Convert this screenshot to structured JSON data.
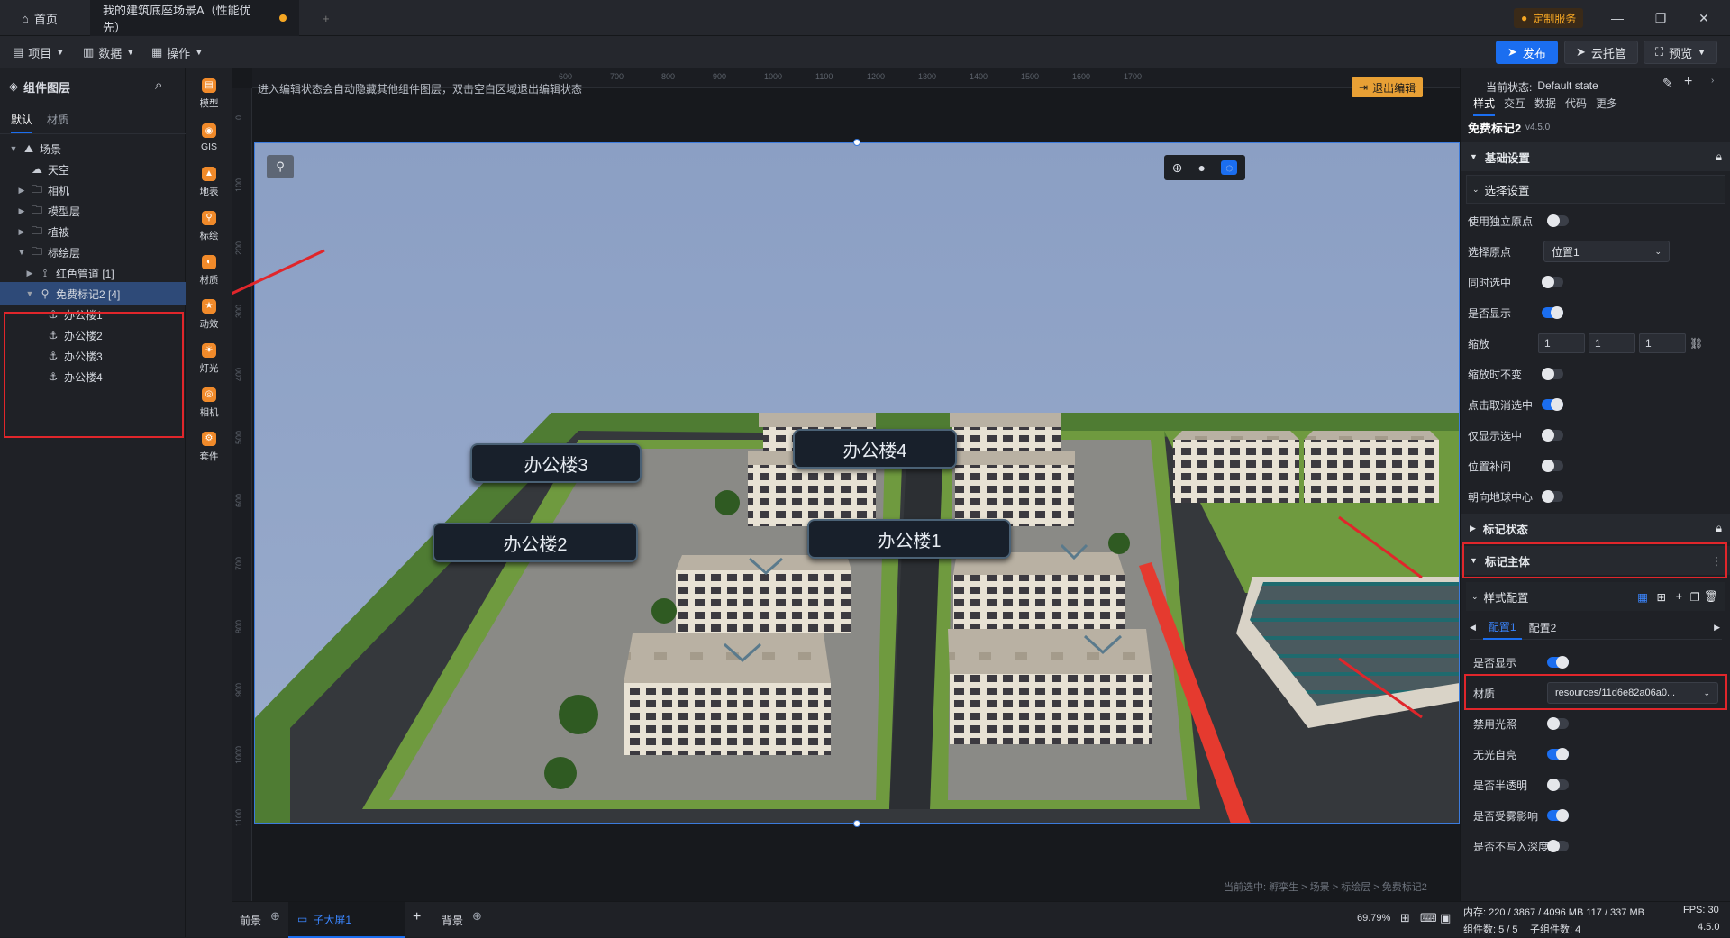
{
  "titlebar": {
    "home_label": "首页",
    "project_tab": "我的建筑底座场景A（性能优先）",
    "add_tab": "+",
    "service_label": "定制服务"
  },
  "menubar": {
    "project": "项目",
    "data": "数据",
    "ops": "操作",
    "publish": "发布",
    "cloud": "云托管",
    "preview": "预览"
  },
  "leftpanel": {
    "title": "组件图层",
    "tabs": [
      "默认",
      "材质"
    ],
    "tree": [
      {
        "label": "场景",
        "icon": "scene-icon",
        "caret": "▼",
        "level": 0
      },
      {
        "label": "天空",
        "icon": "sky-icon",
        "caret": "",
        "level": 1
      },
      {
        "label": "相机",
        "icon": "folder-icon",
        "caret": "▶",
        "level": 1
      },
      {
        "label": "模型层",
        "icon": "folder-icon",
        "caret": "▶",
        "level": 1
      },
      {
        "label": "植被",
        "icon": "folder-icon",
        "caret": "▶",
        "level": 1
      },
      {
        "label": "标绘层",
        "icon": "folder-icon",
        "caret": "▼",
        "level": 1
      },
      {
        "label": "红色管道 [1]",
        "icon": "path-icon",
        "caret": "▶",
        "level": 2
      },
      {
        "label": "免费标记2 [4]",
        "icon": "marker-icon",
        "caret": "▼",
        "level": 2
      },
      {
        "label": "办公楼1",
        "icon": "anchor-icon",
        "caret": "",
        "level": 3
      },
      {
        "label": "办公楼2",
        "icon": "anchor-icon",
        "caret": "",
        "level": 3
      },
      {
        "label": "办公楼3",
        "icon": "anchor-icon",
        "caret": "",
        "level": 3
      },
      {
        "label": "办公楼4",
        "icon": "anchor-icon",
        "caret": "",
        "level": 3
      }
    ]
  },
  "toolbar": {
    "items": [
      "模型",
      "GIS",
      "地表",
      "标绘",
      "材质",
      "动效",
      "灯光",
      "相机",
      "套件"
    ]
  },
  "canvas": {
    "hint": "进入编辑状态会自动隐藏其他组件图层，双击空白区域退出编辑状态",
    "exit_edit": "退出编辑",
    "ruler_top": [
      "600",
      "700",
      "800",
      "900",
      "1000",
      "1100",
      "1200",
      "1300",
      "1400",
      "1500",
      "1600",
      "1700"
    ],
    "ruler_left": [
      "0",
      "100",
      "200",
      "300",
      "400",
      "500",
      "600",
      "700",
      "800",
      "900",
      "1000",
      "1100"
    ],
    "labels": [
      "办公楼3",
      "办公楼4",
      "办公楼2",
      "办公楼1"
    ],
    "breadcrumb": "当前选中: 孵孪生 > 场景 > 标绘层 > 免费标记2"
  },
  "bottombar": {
    "front": "前景",
    "screen": "子大屏1",
    "back": "背景",
    "zoom": "69.79%"
  },
  "rightpanel": {
    "state_label": "当前状态:",
    "state_value": "Default state",
    "tabs": [
      "样式",
      "交互",
      "数据",
      "代码",
      "更多"
    ],
    "component_name": "免费标记2",
    "version": "v4.5.0",
    "sections": {
      "basic": "基础设置",
      "select": "选择设置",
      "marker_state": "标记状态",
      "marker_body": "标记主体",
      "style_config": "样式配置"
    },
    "props": {
      "use_origin": "使用独立原点",
      "select_origin": "选择原点",
      "origin_value": "位置1",
      "multi_select": "同时选中",
      "visible": "是否显示",
      "scale": "缩放",
      "scale_values": [
        "1",
        "1",
        "1"
      ],
      "scale_fixed": "缩放时不变",
      "click_cancel": "点击取消选中",
      "only_show": "仅显示选中",
      "pos_interp": "位置补间",
      "face_center": "朝向地球中心",
      "config_tabs": [
        "配置1",
        "配置2"
      ],
      "body_visible": "是否显示",
      "material": "材质",
      "material_value": "resources/11d6e82a06a0...",
      "disable_light": "禁用光照",
      "no_light_emissive": "无光自亮",
      "semi_trans": "是否半透明",
      "fog": "是否受雾影响",
      "no_depth": "是否不写入深度"
    }
  },
  "statusbar": {
    "memory": "内存: 220 / 3867 / 4096 MB  117 / 337 MB",
    "fps": "FPS: 30",
    "comp_count": "组件数: 5 / 5",
    "sub_count": "子组件数: 4",
    "version": "4.5.0"
  }
}
